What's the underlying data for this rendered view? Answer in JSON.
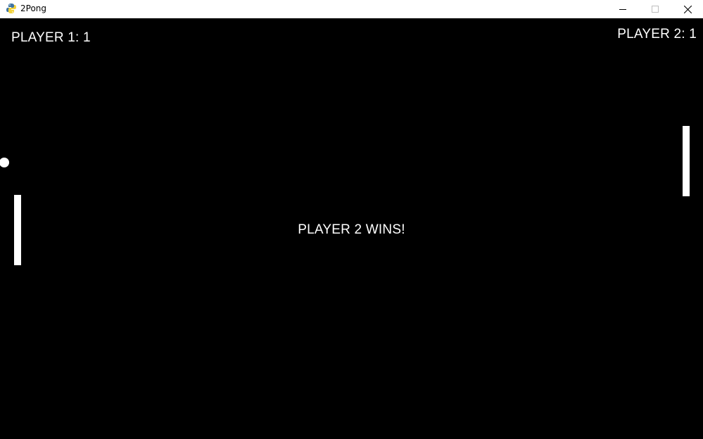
{
  "window": {
    "title": "2Pong",
    "icon": "python-icon",
    "controls": {
      "minimize_icon": "minimize-icon",
      "maximize_icon": "maximize-icon",
      "close_icon": "close-icon"
    }
  },
  "game": {
    "background_color": "#000000",
    "foreground_color": "#ffffff",
    "scores": {
      "player1_text": "PLAYER 1: 1",
      "player2_text": "PLAYER 2: 1"
    },
    "winner_message": "PLAYER 2 WINS!"
  }
}
